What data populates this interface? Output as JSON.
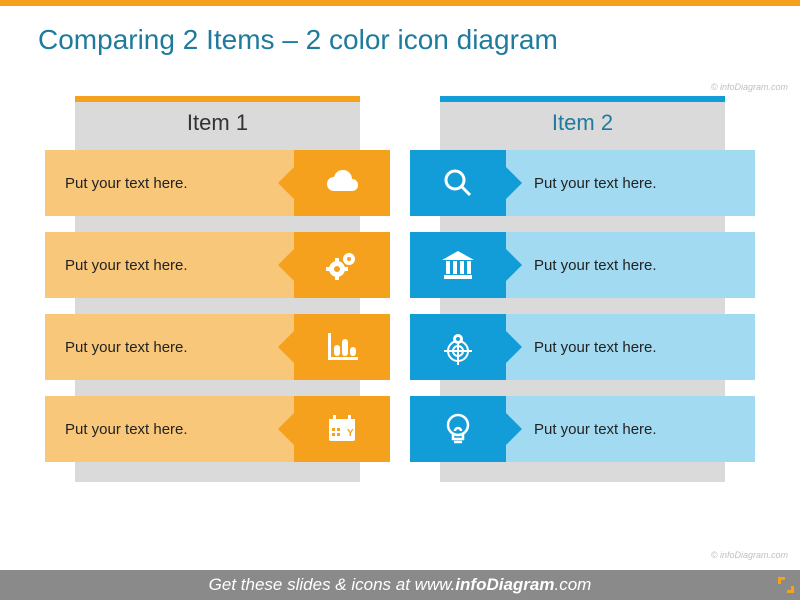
{
  "title": "Comparing 2 Items – 2 color icon diagram",
  "left": {
    "header": "Item 1",
    "rows": [
      {
        "text": "Put your text here.",
        "icon": "cloud-icon"
      },
      {
        "text": "Put your text here.",
        "icon": "gears-icon"
      },
      {
        "text": "Put your text here.",
        "icon": "bar-chart-icon"
      },
      {
        "text": "Put your text here.",
        "icon": "calendar-icon"
      }
    ]
  },
  "right": {
    "header": "Item 2",
    "rows": [
      {
        "text": "Put your text here.",
        "icon": "magnifier-icon"
      },
      {
        "text": "Put your text here.",
        "icon": "bank-icon"
      },
      {
        "text": "Put your text here.",
        "icon": "target-pin-icon"
      },
      {
        "text": "Put your text here.",
        "icon": "lightbulb-icon"
      }
    ]
  },
  "watermark": "© infoDiagram.com",
  "footer_prefix": "Get these slides & icons at ",
  "footer_site_prefix": "www.",
  "footer_site_bold": "infoDiagram",
  "footer_site_suffix": ".com",
  "colors": {
    "orange": "#f6a11d",
    "orange_light": "#f9c77a",
    "blue": "#139dd8",
    "blue_light": "#a2daf2"
  }
}
